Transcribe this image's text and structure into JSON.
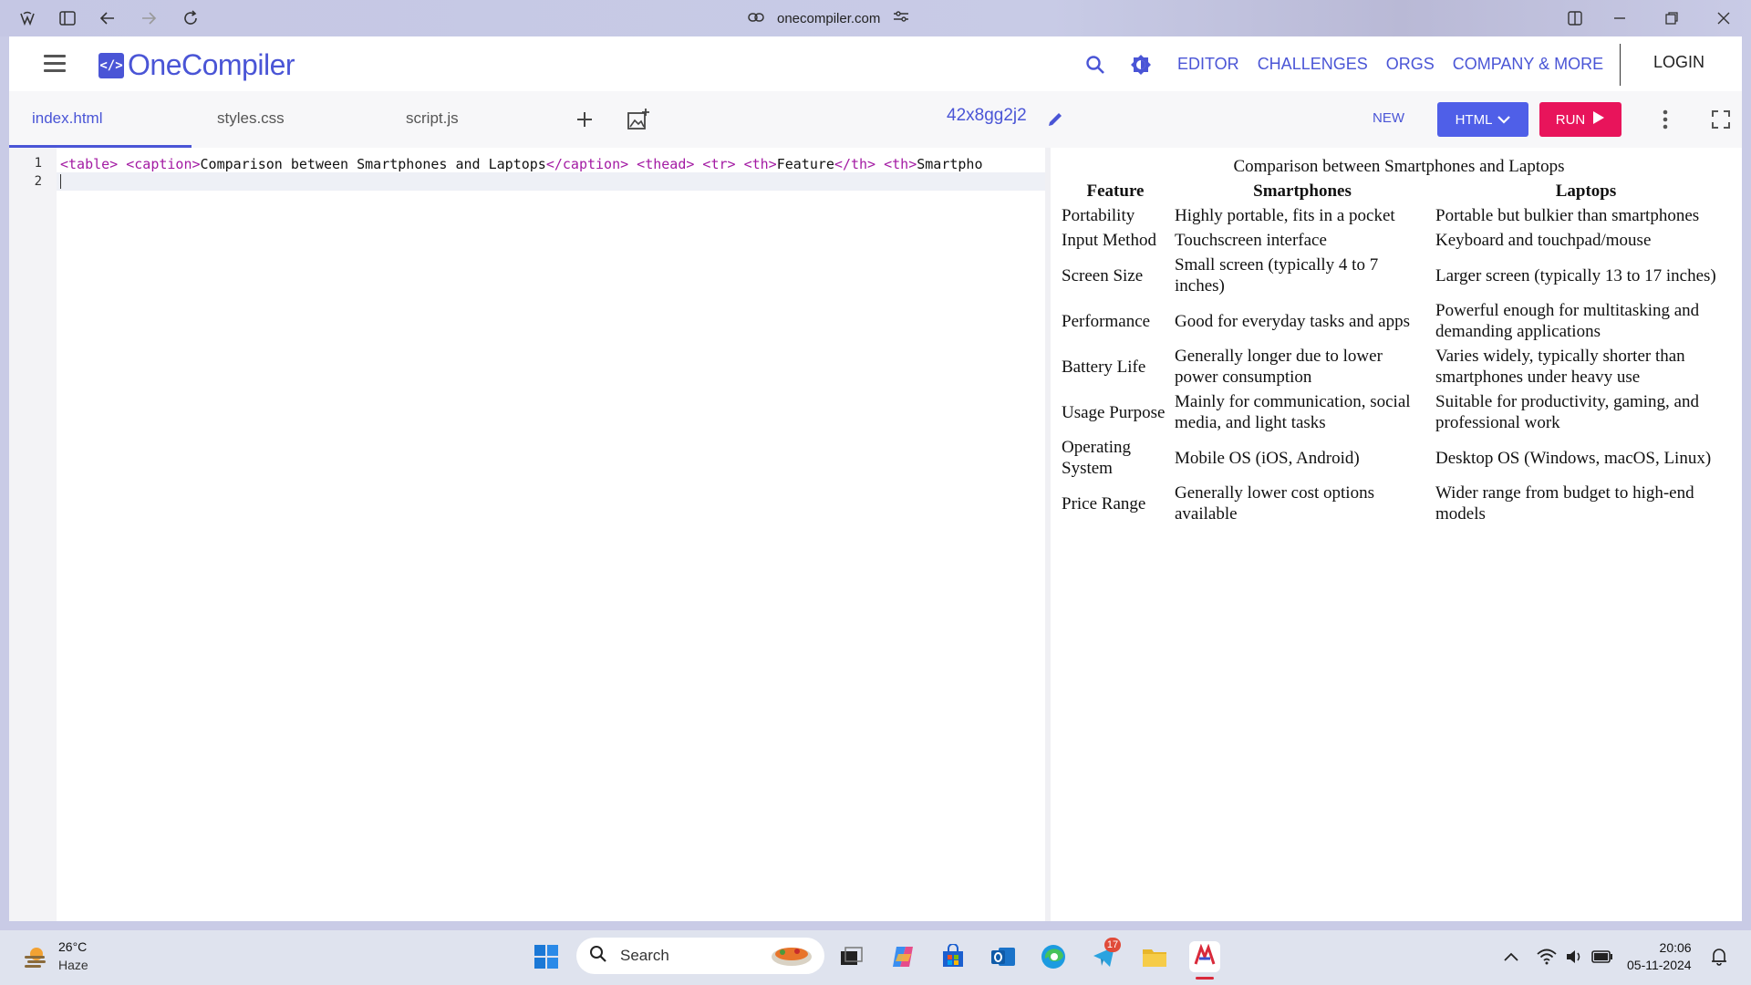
{
  "browser": {
    "url": "onecompiler.com"
  },
  "app": {
    "brand": "OneCompiler",
    "nav": {
      "editor": "EDITOR",
      "challenges": "CHALLENGES",
      "orgs": "ORGS",
      "company": "COMPANY & MORE",
      "login": "LOGIN"
    },
    "tabs": [
      "index.html",
      "styles.css",
      "script.js"
    ],
    "project_name": "42x8gg2j2",
    "new_label": "NEW",
    "language_label": "HTML",
    "run_label": "RUN",
    "accent": "#4a55d6",
    "run_color": "#e8145b"
  },
  "editor": {
    "line_numbers": [
      "1",
      "2"
    ],
    "code_parts": [
      {
        "t": "tag",
        "v": "<table>"
      },
      {
        "t": "txt",
        "v": " "
      },
      {
        "t": "tag",
        "v": "<caption>"
      },
      {
        "t": "txt",
        "v": "Comparison between Smartphones and Laptops"
      },
      {
        "t": "tag",
        "v": "</caption>"
      },
      {
        "t": "txt",
        "v": " "
      },
      {
        "t": "tag",
        "v": "<thead>"
      },
      {
        "t": "txt",
        "v": " "
      },
      {
        "t": "tag",
        "v": "<tr>"
      },
      {
        "t": "txt",
        "v": " "
      },
      {
        "t": "tag",
        "v": "<th>"
      },
      {
        "t": "txt",
        "v": "Feature"
      },
      {
        "t": "tag",
        "v": "</th>"
      },
      {
        "t": "txt",
        "v": " "
      },
      {
        "t": "tag",
        "v": "<th>"
      },
      {
        "t": "txt",
        "v": "Smartpho"
      }
    ]
  },
  "output": {
    "caption": "Comparison between Smartphones and Laptops",
    "headers": [
      "Feature",
      "Smartphones",
      "Laptops"
    ],
    "rows": [
      [
        "Portability",
        "Highly portable, fits in a pocket",
        "Portable but bulkier than smartphones"
      ],
      [
        "Input Method",
        "Touchscreen interface",
        "Keyboard and touchpad/mouse"
      ],
      [
        "Screen Size",
        "Small screen (typically 4 to 7 inches)",
        "Larger screen (typically 13 to 17 inches)"
      ],
      [
        "Performance",
        "Good for everyday tasks and apps",
        "Powerful enough for multitasking and demanding applications"
      ],
      [
        "Battery Life",
        "Generally longer due to lower power consumption",
        "Varies widely, typically shorter than smartphones under heavy use"
      ],
      [
        "Usage Purpose",
        "Mainly for communication, social media, and light tasks",
        "Suitable for productivity, gaming, and professional work"
      ],
      [
        "Operating System",
        "Mobile OS (iOS, Android)",
        "Desktop OS (Windows, macOS, Linux)"
      ],
      [
        "Price Range",
        "Generally lower cost options available",
        "Wider range from budget to high-end models"
      ]
    ]
  },
  "taskbar": {
    "temperature": "26°C",
    "condition": "Haze",
    "search_label": "Search",
    "telegram_badge": "17",
    "time": "20:06",
    "date": "05-11-2024"
  }
}
